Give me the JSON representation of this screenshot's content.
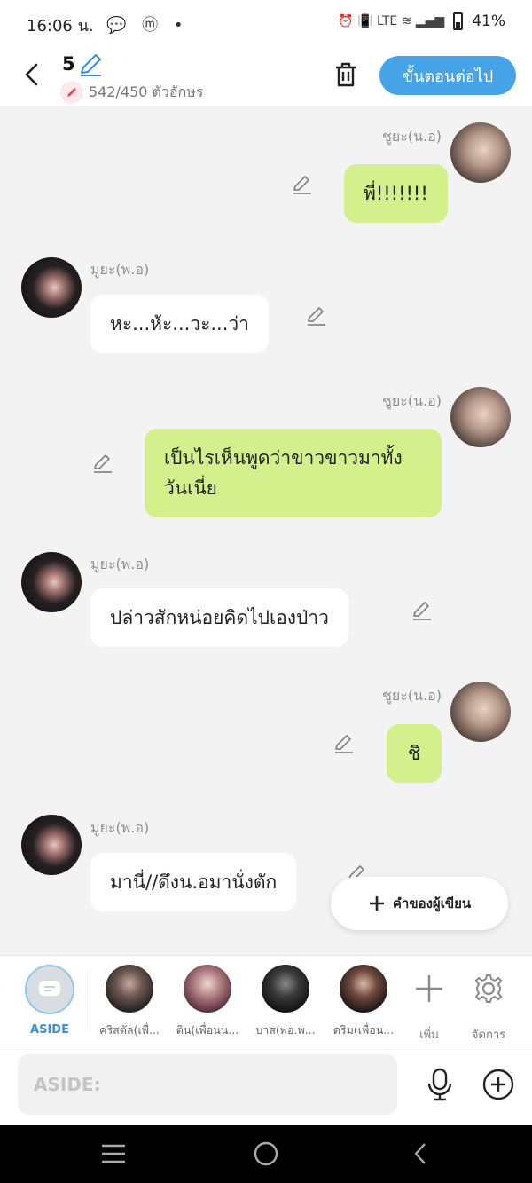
{
  "status": {
    "time": "16:06 น.",
    "notifications": "💬 ⓜ •",
    "icons": "⏰ 📳 LTE ≋ ▂▄▆",
    "battery": "41%"
  },
  "header": {
    "episode": "5",
    "count": "542/450 ตัวอักษร",
    "next_label": "ขั้นตอนต่อไป"
  },
  "messages": [
    {
      "side": "right",
      "name": "ชูยะ(น.อ)",
      "text": "พี่!!!!!!!"
    },
    {
      "side": "left",
      "name": "มูยะ(พ.อ)",
      "text": "หะ...ห้ะ...วะ...ว่า"
    },
    {
      "side": "right",
      "name": "ชูยะ(น.อ)",
      "text": "เป็นไรเห็นพูดว่าขาวขาวมาทั้งวันเนี่ย"
    },
    {
      "side": "left",
      "name": "มูยะ(พ.อ)",
      "text": "ปล่าวสักหน่อยคิดไปเองป่าว"
    },
    {
      "side": "right",
      "name": "ชูยะ(น.อ)",
      "text": "ชิ"
    },
    {
      "side": "left",
      "name": "มูยะ(พ.อ)",
      "text": "มานี่//ดึงน.อมานั่งตัก"
    }
  ],
  "fab": {
    "label": "คำของผู้เขียน"
  },
  "characters": [
    {
      "name": "ASIDE",
      "color": "#d8dde2"
    },
    {
      "name": "คริสตัล(เพื่...",
      "color": "#3b3636"
    },
    {
      "name": "ติน(เพื่อนน...",
      "color": "#7a4b57"
    },
    {
      "name": "บาส(พ่อ.พ...",
      "color": "#1f1f1f"
    },
    {
      "name": "ดริม(เพื่อน...",
      "color": "#3a2a2a"
    }
  ],
  "tools": {
    "add": "เพิ่ม",
    "manage": "จัดการ"
  },
  "input": {
    "placeholder": "ASIDE:"
  },
  "colors": {
    "accent": "#46a3e8",
    "bubble_green": "#d4f08c",
    "bubble_white": "#ffffff",
    "background": "#f3f3f3"
  }
}
